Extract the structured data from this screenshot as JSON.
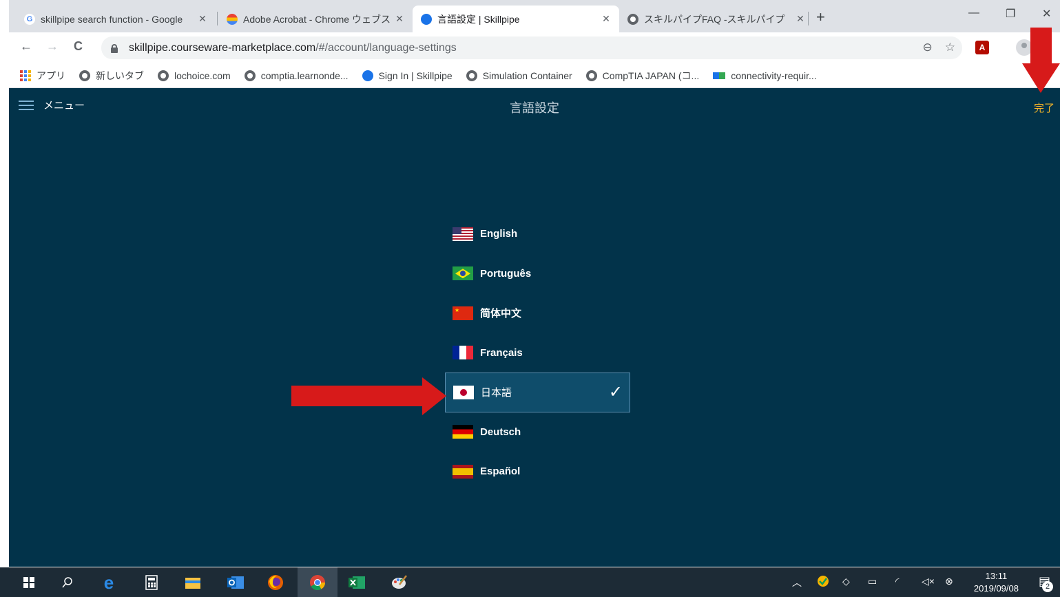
{
  "browser": {
    "tabs": [
      {
        "title": "skillpipe search function - Google",
        "favicon": "google-g-icon",
        "close": "✕"
      },
      {
        "title": "Adobe Acrobat - Chrome ウェブスト",
        "favicon": "acrobat-rainbow-icon",
        "close": "✕"
      },
      {
        "title": "言語設定 | Skillpipe",
        "favicon": "skillpipe-icon",
        "close": "✕",
        "active": true
      },
      {
        "title": "スキルパイプFAQ -スキルパイプ",
        "favicon": "globe-icon",
        "close": "✕"
      }
    ],
    "new_tab": "+",
    "window_controls": {
      "minimize": "—",
      "restore": "❐",
      "close": "✕"
    },
    "nav": {
      "back": "←",
      "forward": "→",
      "reload": "C"
    },
    "url": {
      "host": "skillpipe.courseware-marketplace.com",
      "path": "/#/account/language-settings"
    },
    "omnibox_icons": {
      "zoom": "⊖",
      "star": "☆"
    },
    "extension_pdf_label": "A",
    "bookmarks": [
      {
        "label": "アプリ",
        "icon": "apps-grid-icon"
      },
      {
        "label": "新しいタブ",
        "icon": "globe-icon"
      },
      {
        "label": "lochoice.com",
        "icon": "globe-icon"
      },
      {
        "label": "comptia.learnonde...",
        "icon": "globe-icon"
      },
      {
        "label": "Sign In | Skillpipe",
        "icon": "skillpipe-icon"
      },
      {
        "label": "Simulation Container",
        "icon": "globe-icon"
      },
      {
        "label": "CompTIA JAPAN (コ...",
        "icon": "globe-icon"
      },
      {
        "label": "connectivity-requir...",
        "icon": "blue-tiles-icon"
      }
    ]
  },
  "app": {
    "menu_label": "メニュー",
    "title": "言語設定",
    "done_label": "完了",
    "languages": [
      {
        "label": "English",
        "flag": "us-flag-icon",
        "selected": false
      },
      {
        "label": "Português",
        "flag": "brazil-flag-icon",
        "selected": false
      },
      {
        "label": "简体中文",
        "flag": "china-flag-icon",
        "selected": false
      },
      {
        "label": "Français",
        "flag": "france-flag-icon",
        "selected": false
      },
      {
        "label": "日本語",
        "flag": "japan-flag-icon",
        "selected": true
      },
      {
        "label": "Deutsch",
        "flag": "germany-flag-icon",
        "selected": false
      },
      {
        "label": "Español",
        "flag": "spain-flag-icon",
        "selected": false
      }
    ],
    "check_mark": "✓",
    "colors": {
      "background": "#02334a",
      "done": "#f0b429",
      "selected_bg": "#0f4d6b",
      "annotation_arrow": "#d71a1a"
    }
  },
  "taskbar": {
    "icons": [
      "windows-start-icon",
      "search-icon",
      "internet-explorer-icon",
      "calculator-icon",
      "file-explorer-icon",
      "outlook-icon",
      "firefox-icon",
      "chrome-icon",
      "excel-icon",
      "paint-icon"
    ],
    "tray_icons": [
      "chevron-up-icon",
      "security-icon",
      "dropbox-icon",
      "battery-icon",
      "wifi-icon",
      "volume-muted-icon",
      "error-icon"
    ],
    "time": "13:11",
    "date": "2019/09/08",
    "notification_count": "2"
  }
}
